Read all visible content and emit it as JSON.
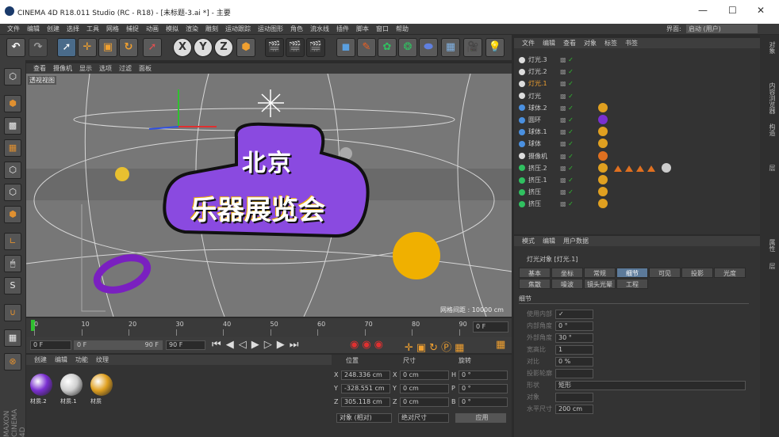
{
  "window": {
    "title": "CINEMA 4D R18.011 Studio (RC - R18) - [未标题-3.ai *] - 主要"
  },
  "menu": [
    "文件",
    "编辑",
    "创建",
    "选择",
    "工具",
    "网格",
    "捕捉",
    "动画",
    "模拟",
    "渲染",
    "雕刻",
    "运动跟踪",
    "运动图形",
    "角色",
    "流水线",
    "插件",
    "脚本",
    "窗口",
    "帮助"
  ],
  "layout": {
    "label": "界面:",
    "value": "启动 (用户)"
  },
  "toolbar": {
    "x": "X",
    "y": "Y",
    "z": "Z"
  },
  "viewport": {
    "menu": [
      "查看",
      "摄像机",
      "显示",
      "选项",
      "过滤",
      "面板"
    ],
    "label": "透视视图",
    "grid_info": "网格间距 : 10000 cm",
    "logo_line1": "北京",
    "logo_line2": "乐器展览会"
  },
  "timeline": {
    "ticks": [
      "0",
      "10",
      "20",
      "30",
      "40",
      "50",
      "60",
      "70",
      "80",
      "90"
    ],
    "current": "0 F"
  },
  "transport": {
    "start": "0 F",
    "range_start": "0 F",
    "range_end": "90 F",
    "end": "90 F"
  },
  "materials": {
    "menu": [
      "创建",
      "编辑",
      "功能",
      "纹理"
    ],
    "items": [
      {
        "name": "材质.2",
        "color": "#7a2fd0"
      },
      {
        "name": "材质.1",
        "color": "#cfcfcf"
      },
      {
        "name": "材质",
        "color": "#e0a020"
      }
    ]
  },
  "coords": {
    "headers": [
      "位置",
      "尺寸",
      "旋转"
    ],
    "rows": [
      {
        "a": "X",
        "pos": "248.336 cm",
        "b": "X",
        "size": "0 cm",
        "c": "H",
        "rot": "0 °"
      },
      {
        "a": "Y",
        "pos": "-328.551 cm",
        "b": "Y",
        "size": "0 cm",
        "c": "P",
        "rot": "0 °"
      },
      {
        "a": "Z",
        "pos": "305.118 cm",
        "b": "Z",
        "size": "0 cm",
        "c": "B",
        "rot": "0 °"
      }
    ],
    "mode": "对象 (相对)",
    "size_mode": "绝对尺寸",
    "apply": "应用"
  },
  "objects": {
    "menu": [
      "文件",
      "编辑",
      "查看",
      "对象",
      "标签",
      "书签"
    ],
    "items": [
      {
        "name": "灯光.3",
        "type": "light"
      },
      {
        "name": "灯光.2",
        "type": "light"
      },
      {
        "name": "灯光.1",
        "type": "light",
        "selected": true
      },
      {
        "name": "灯光",
        "type": "light"
      },
      {
        "name": "球体.2",
        "type": "sphere"
      },
      {
        "name": "圆环",
        "type": "torus"
      },
      {
        "name": "球体.1",
        "type": "sphere"
      },
      {
        "name": "球体",
        "type": "sphere"
      },
      {
        "name": "摄像机",
        "type": "camera"
      },
      {
        "name": "挤压.2",
        "type": "extrude"
      },
      {
        "name": "挤压.1",
        "type": "extrude"
      },
      {
        "name": "挤压",
        "type": "extrude"
      },
      {
        "name": "挤压",
        "type": "extrude"
      }
    ]
  },
  "attributes": {
    "menu": [
      "模式",
      "编辑",
      "用户数据"
    ],
    "title": "灯光对象 [灯光.1]",
    "tabs_row1": [
      "基本",
      "坐标",
      "常规",
      "细节",
      "可见",
      "投影",
      "光度"
    ],
    "tabs_row2": [
      "焦散",
      "噪波",
      "镜头光晕",
      "工程"
    ],
    "section": "细节",
    "fields": [
      {
        "label": "使用内部",
        "value": "✓"
      },
      {
        "label": "内部角度",
        "value": "0 °"
      },
      {
        "label": "外部角度",
        "value": "30 °"
      },
      {
        "label": "宽高比",
        "value": "1"
      },
      {
        "label": "对比",
        "value": "0 %"
      },
      {
        "label": "投影轮廓",
        "value": ""
      },
      {
        "label": "形状",
        "value": "矩形"
      },
      {
        "label": "对象",
        "value": ""
      },
      {
        "label": "水平尺寸",
        "value": "200 cm"
      }
    ]
  },
  "righttabs": [
    "对象",
    "内容浏览器",
    "构造",
    "层"
  ],
  "righttabs2": [
    "属性",
    "层"
  ]
}
